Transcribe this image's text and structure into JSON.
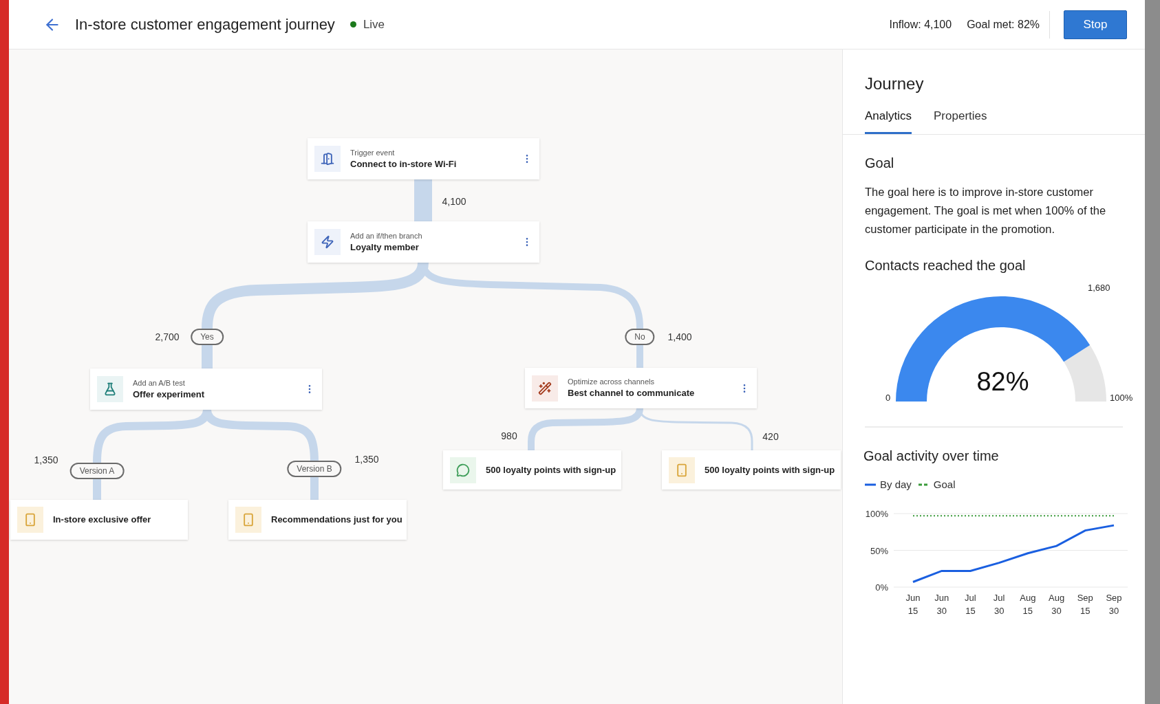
{
  "header": {
    "title": "In-store customer engagement journey",
    "status": {
      "label": "Live",
      "live": true
    },
    "inflow": "Inflow: 4,100",
    "goal_met": "Goal met: 82%",
    "stop_button": "Stop"
  },
  "canvas": {
    "nodes": [
      {
        "kind": "trigger",
        "caption": "Trigger event",
        "title": "Connect to in-store Wi-Fi"
      },
      {
        "kind": "branch",
        "caption": "Add an if/then branch",
        "title": "Loyalty member"
      },
      {
        "kind": "ab_test",
        "caption": "Add an A/B test",
        "title": "Offer experiment"
      },
      {
        "kind": "optimize",
        "caption": "Optimize across channels",
        "title": "Best channel to communicate"
      },
      {
        "kind": "push",
        "title": "In-store exclusive offer"
      },
      {
        "kind": "push",
        "title": "Recommendations just for you"
      },
      {
        "kind": "sms",
        "title": "500 loyalty points with sign-up"
      },
      {
        "kind": "push",
        "title": "500 loyalty points with sign-up"
      }
    ],
    "counts": [
      "4,100",
      "2,700",
      "1,400",
      "1,350",
      "1,350",
      "980",
      "420"
    ],
    "branch_labels": [
      "Yes",
      "No",
      "Version A",
      "Version B"
    ]
  },
  "panel": {
    "title": "Journey",
    "tabs": [
      {
        "label": "Analytics",
        "selected": true
      },
      {
        "label": "Properties",
        "selected": false
      }
    ],
    "goal_heading": "Goal",
    "goal_text": "The goal here is to improve in-store customer engagement. The goal is met when 100% of the customer participate in the promotion.",
    "gauge_heading": "Contacts reached the goal",
    "gauge": {
      "value": "82%",
      "min_label": "0",
      "max_label": "100%",
      "target_label": "1,680"
    },
    "activity_heading": "Goal activity over time",
    "chart_data": {
      "type": "line",
      "categories": [
        "Jun 15",
        "Jun 30",
        "Jul 15",
        "Jul 30",
        "Aug 15",
        "Aug 30",
        "Sep 15",
        "Sep 30"
      ],
      "series": [
        {
          "name": "By day",
          "color": "#1a5fe0",
          "line_style": "solid",
          "values": [
            7,
            22,
            22,
            33,
            46,
            56,
            77,
            84
          ]
        },
        {
          "name": "Goal",
          "color": "#3a9a3a",
          "line_style": "dashed",
          "values": [
            97,
            97,
            97,
            97,
            97,
            97,
            97,
            97
          ]
        }
      ],
      "ylim": [
        0,
        100
      ],
      "yticks": [
        {
          "value": 0,
          "label": "0%"
        },
        {
          "value": 50,
          "label": "50%"
        },
        {
          "value": 100,
          "label": "100%"
        }
      ]
    }
  }
}
